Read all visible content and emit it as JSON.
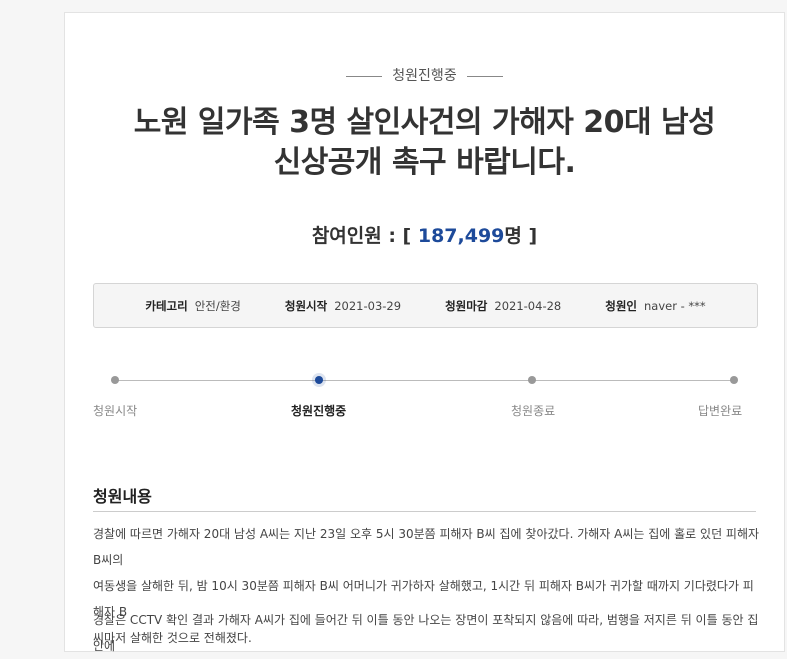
{
  "petition": {
    "status": "청원진행중",
    "title_line1": "노원 일가족 3명 살인사건의 가해자 20대 남성",
    "title_line2": "신상공개 촉구 바랍니다.",
    "participants_label": "참여인원 : [ ",
    "participants_value": "187,499",
    "participants_suffix": "명 ]"
  },
  "info": {
    "category_label": "카테고리",
    "category_value": "안전/환경",
    "start_label": "청원시작",
    "start_value": "2021-03-29",
    "end_label": "청원마감",
    "end_value": "2021-04-28",
    "author_label": "청원인",
    "author_value": "naver - ***"
  },
  "progress": {
    "steps": [
      "청원시작",
      "청원진행중",
      "청원종료",
      "답변완료"
    ],
    "active_index": 1
  },
  "content": {
    "heading": "청원내용",
    "para1_line1": "경찰에 따르면 가해자 20대 남성 A씨는 지난 23일 오후 5시 30분쯤 피해자 B씨 집에 찾아갔다. 가해자 A씨는 집에 홀로 있던 피해자 B씨의",
    "para1_line2": "여동생을 살해한 뒤, 밤 10시 30분쯤 피해자 B씨 어머니가 귀가하자 살해했고, 1시간 뒤 피해자 B씨가 귀가할 때까지 기다렸다가 피해자 B",
    "para1_line3": "씨마저 살해한 것으로 전해졌다.",
    "para2_line1": "경찰은 CCTV 확인 결과 가해자 A씨가 집에 들어간 뒤 이틀 동안 나오는 장면이 포착되지 않음에 따라, 범행을 저지른 뒤 이틀 동안 집안에"
  }
}
